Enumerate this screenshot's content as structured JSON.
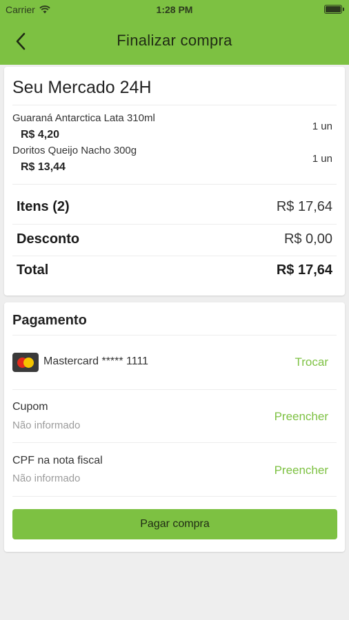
{
  "status_bar": {
    "carrier": "Carrier",
    "time": "1:28 PM"
  },
  "header": {
    "title": "Finalizar compra"
  },
  "order": {
    "store_name": "Seu Mercado 24H",
    "items": [
      {
        "name": "Guaraná Antarctica Lata 310ml",
        "price": "R$ 4,20",
        "qty": "1 un"
      },
      {
        "name": "Doritos Queijo Nacho 300g",
        "price": "R$ 13,44",
        "qty": "1 un"
      }
    ],
    "summary": {
      "items_label": "Itens (2)",
      "items_value": "R$ 17,64",
      "discount_label": "Desconto",
      "discount_value": "R$ 0,00",
      "total_label": "Total",
      "total_value": "R$ 17,64"
    }
  },
  "payment": {
    "title": "Pagamento",
    "card_label": "Mastercard ***** 1111",
    "card_icon": "mastercard-icon",
    "change_label": "Trocar",
    "coupon_label": "Cupom",
    "coupon_value": "Não informado",
    "coupon_action": "Preencher",
    "cpf_label": "CPF na nota fiscal",
    "cpf_value": "Não informado",
    "cpf_action": "Preencher",
    "pay_button": "Pagar compra"
  },
  "colors": {
    "accent": "#7dc142",
    "background": "#eeeeee"
  }
}
